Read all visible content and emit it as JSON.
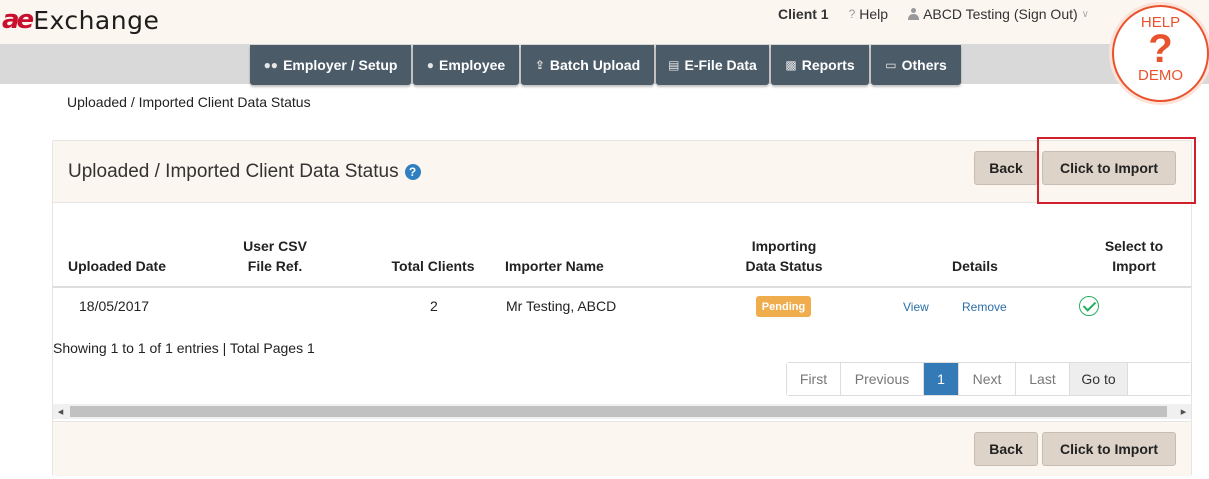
{
  "logo": {
    "mark": "ae",
    "text": "Exchange"
  },
  "top": {
    "client": "Client 1",
    "help": "Help",
    "user": "ABCD Testing (Sign Out)"
  },
  "help_badge": {
    "top": "HELP",
    "mark": "?",
    "bottom": "DEMO"
  },
  "nav": [
    {
      "label": "Employer / Setup",
      "icon": "users-icon"
    },
    {
      "label": "Employee",
      "icon": "user-icon"
    },
    {
      "label": "Batch Upload",
      "icon": "upload-icon"
    },
    {
      "label": "E-File Data",
      "icon": "file-icon"
    },
    {
      "label": "Reports",
      "icon": "bar-chart-icon"
    },
    {
      "label": "Others",
      "icon": "folder-icon"
    }
  ],
  "breadcrumb": "Uploaded / Imported Client Data Status",
  "panel": {
    "title": "Uploaded / Imported Client Data Status",
    "back_label": "Back",
    "import_label": "Click to Import"
  },
  "table": {
    "headers": {
      "uploaded_date": "Uploaded Date",
      "csv_ref_1": "User CSV",
      "csv_ref_2": "File Ref.",
      "total_clients": "Total Clients",
      "importer": "Importer Name",
      "status_1": "Importing",
      "status_2": "Data Status",
      "details": "Details",
      "select_1": "Select to",
      "select_2": "Import"
    },
    "rows": [
      {
        "uploaded_date": "18/05/2017",
        "csv_ref": "",
        "total_clients": "2",
        "importer": "Mr Testing, ABCD",
        "status": "Pending",
        "view": "View",
        "remove": "Remove"
      }
    ]
  },
  "showing": "Showing 1 to 1 of 1 entries | Total Pages 1",
  "pager": {
    "first": "First",
    "previous": "Previous",
    "current": "1",
    "next": "Next",
    "last": "Last",
    "goto": "Go to"
  },
  "colors": {
    "nav": "#4c5b68",
    "accent_red": "#c8102e",
    "badge_orange": "#e8532e",
    "pending": "#f0ad4e",
    "active_page": "#337ab7"
  }
}
